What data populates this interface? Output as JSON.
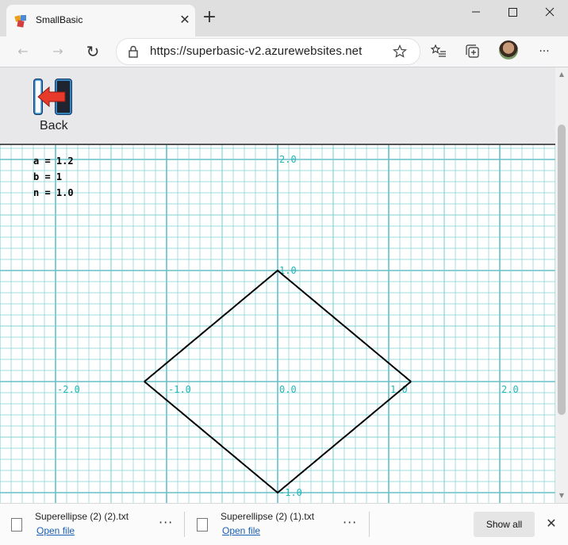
{
  "browser": {
    "tab_title": "SmallBasic",
    "tab_close": "✕",
    "new_tab": "+",
    "url": "https://superbasic-v2.azurewebsites.net",
    "window": {
      "minimize": "—",
      "maximize": "☐",
      "close": "✕"
    },
    "nav": {
      "back": "←",
      "forward": "→",
      "refresh": "↻",
      "more": "···"
    }
  },
  "toolbar": {
    "back_label": "Back"
  },
  "graph": {
    "variables": [
      "a = 1.2",
      "b = 1",
      "n = 1.0"
    ],
    "x_labels": [
      "-2.0",
      "-1.0",
      "0.0",
      "1.0",
      "2.0"
    ],
    "y_labels": [
      "2.0",
      "1.0",
      "-1.0"
    ],
    "curve": {
      "a": 1.2,
      "b": 1,
      "n": 1.0
    },
    "colors": {
      "grid": "#7fd0d0",
      "grid_major": "#66c0c8",
      "labels": "#20b8b8",
      "curve": "#000000"
    }
  },
  "downloads": {
    "items": [
      {
        "name": "Superellipse (2) (2).txt",
        "action": "Open file"
      },
      {
        "name": "Superellipse (2) (1).txt",
        "action": "Open file"
      }
    ],
    "more": "···",
    "show_all": "Show all",
    "close": "✕"
  }
}
